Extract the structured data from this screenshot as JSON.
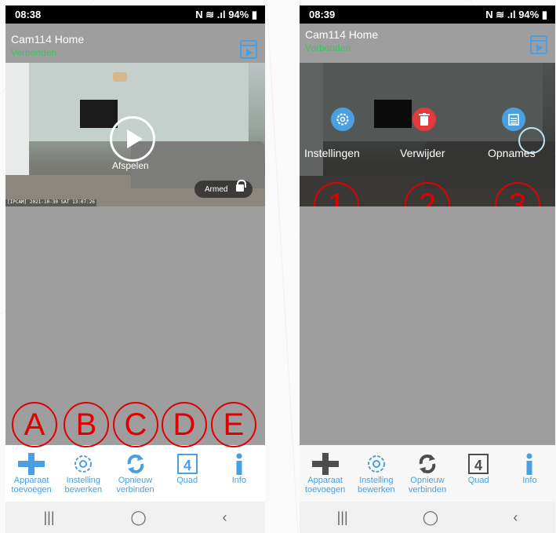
{
  "left": {
    "status_time": "08:38",
    "status_icons": "N ≋ .ıl 94% ▮",
    "cam_title": "Cam114 Home",
    "cam_status": "Verbonden",
    "timestamp": "[IPCAM] 2021-10-30 SAT 13:07:26",
    "play_label": "Afspelen",
    "armed_label": "Armed",
    "nav": [
      {
        "icon": "plus-icon",
        "label1": "Apparaat",
        "label2": "toevoegen"
      },
      {
        "icon": "gear-icon",
        "label1": "Instelling",
        "label2": "bewerken"
      },
      {
        "icon": "refresh-icon",
        "label1": "Opnieuw",
        "label2": "verbinden"
      },
      {
        "icon": "quad-icon",
        "label1": "Quad",
        "label2": ""
      },
      {
        "icon": "info-icon",
        "label1": "Info",
        "label2": ""
      }
    ],
    "annotations": [
      "A",
      "B",
      "C",
      "D",
      "E"
    ]
  },
  "right": {
    "status_time": "08:39",
    "status_icons": "N ≋ .ıl 94% ▮",
    "cam_title": "Cam114 Home",
    "cam_status": "Verbonden",
    "menu": [
      {
        "icon": "gear-icon",
        "label": "Instellingen",
        "color": "#4a9fe0"
      },
      {
        "icon": "trash-icon",
        "label": "Verwijder",
        "color": "#e33b3b"
      },
      {
        "icon": "calendar-list-icon",
        "label": "Opnames",
        "color": "#4a9fe0"
      }
    ],
    "annotations": [
      "1",
      "2",
      "3"
    ]
  },
  "colors": {
    "accent": "#4a9fe0",
    "connected": "#34c759",
    "annotation_red": "#e00000",
    "app_gray": "#9e9e9e"
  }
}
